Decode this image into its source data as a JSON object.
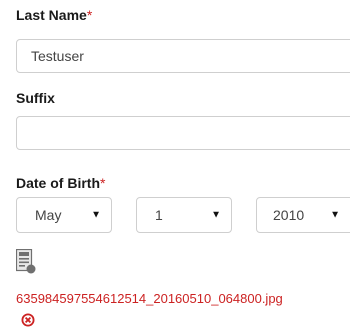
{
  "last_name": {
    "label": "Last Name",
    "required_mark": "*",
    "value": "Testuser"
  },
  "suffix": {
    "label": "Suffix",
    "value": ""
  },
  "dob": {
    "label": "Date of Birth",
    "required_mark": "*",
    "month": "May",
    "day": "1",
    "year": "2010"
  },
  "attachment": {
    "icon": "document-icon",
    "filename": "635984597554612514_20160510_064800.jpg",
    "remove_icon": "remove-circle-icon",
    "accent_color": "#cc2222"
  }
}
